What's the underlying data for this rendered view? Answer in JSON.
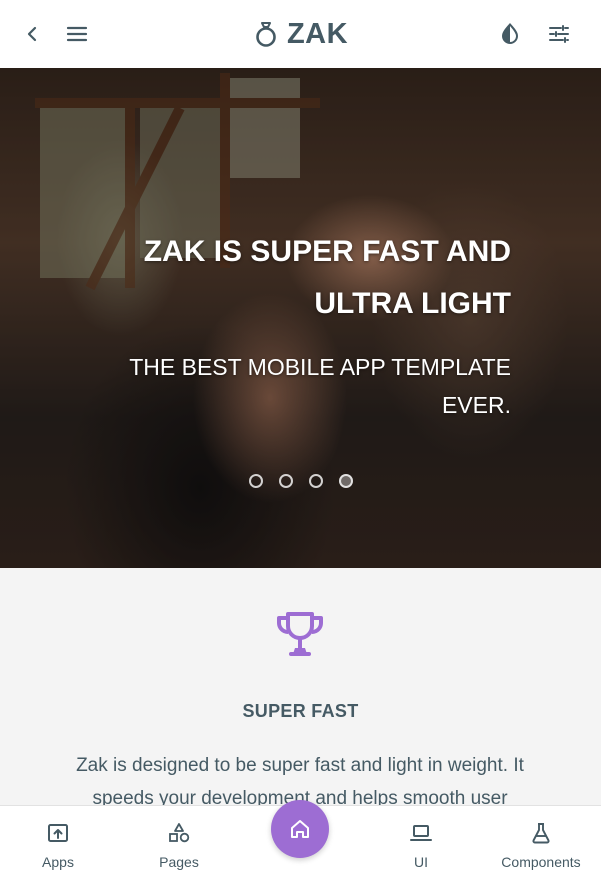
{
  "header": {
    "brand_name": "ZAK",
    "back_icon": "chevron-left-icon",
    "menu_icon": "hamburger-menu-icon",
    "brand_icon": "ring-icon",
    "theme_icon": "contrast-icon",
    "settings_icon": "sliders-icon"
  },
  "hero": {
    "title": "ZAK IS SUPER FAST AND ULTRA LIGHT",
    "subtitle": "THE BEST MOBILE APP TEMPLATE EVER.",
    "slide_count": 4,
    "active_slide": 4
  },
  "feature": {
    "icon": "trophy-icon",
    "title": "SUPER FAST",
    "text": "Zak is designed to be super fast and light in weight. It speeds your development and helps smooth user"
  },
  "bottom_nav": {
    "items": [
      {
        "label": "Apps",
        "icon": "upload-box-icon"
      },
      {
        "label": "Pages",
        "icon": "shapes-icon"
      },
      {
        "label": "",
        "icon": "home-icon"
      },
      {
        "label": "UI",
        "icon": "laptop-icon"
      },
      {
        "label": "Components",
        "icon": "flask-icon"
      }
    ]
  },
  "colors": {
    "primary_text": "#455a64",
    "accent": "#9d6dd3",
    "background": "#f4f4f4"
  }
}
